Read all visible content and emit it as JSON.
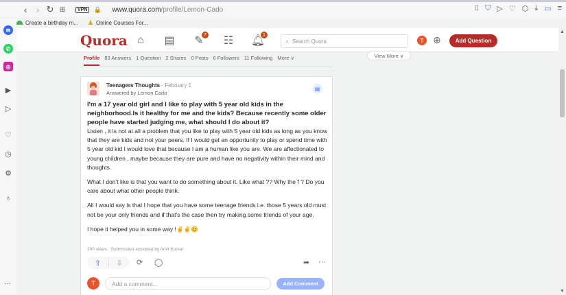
{
  "browser": {
    "vpn_label": "VPN",
    "url_host": "www.quora.com",
    "url_path": "/profile/Lemon-Cado",
    "bookmarks": [
      "Create a birthday m...",
      "Online Courses For..."
    ]
  },
  "header": {
    "logo": "Quora",
    "search_placeholder": "Search Quora",
    "following_badge": "7",
    "notifications_badge": "1",
    "avatar_initial": "T",
    "add_question": "Add Question"
  },
  "profile_tabs": [
    "Profile",
    "83 Answers",
    "1 Question",
    "2 Shares",
    "0 Posts",
    "6 Followers",
    "11 Following",
    "More ∨"
  ],
  "view_more": "View More ∨",
  "answer": {
    "author": "Teenagers Thoughts",
    "date": "· February 1",
    "answered_by": "Answered by Lemon Cado",
    "question": "I'm a 17 year old girl and I like to play with 5 year old kids in the neighborhood.Is it healthy for me and the kids? Because recently some older people have started judging me, what should I do about it?",
    "paragraphs": [
      "Listen , it is not at all a problem that you like to play with 5 year old kids as long as you know that they are kids and not your peers. If I would get an opportunity to play or spend time with 5 year old kid I would love that because I am a human like you are. We are affectionated to young children , maybe because they are pure and have no negativity within their mind and thoughts.",
      "What I don't like is that you want to do something about it. Like what ?? Why the f ? Do you care about what other people think.",
      "All I would say is that I hope that you have some teenage friends i.e. those 5 years old must not be your only friends and if that's the case then try making some friends of your age.",
      "I hope it helped you in some way !✌✌😊"
    ],
    "meta": "200 views · Submission accepted by Amit Kumar",
    "comment_avatar": "T",
    "comment_placeholder": "Add a comment...",
    "comment_button": "Add Comment"
  }
}
